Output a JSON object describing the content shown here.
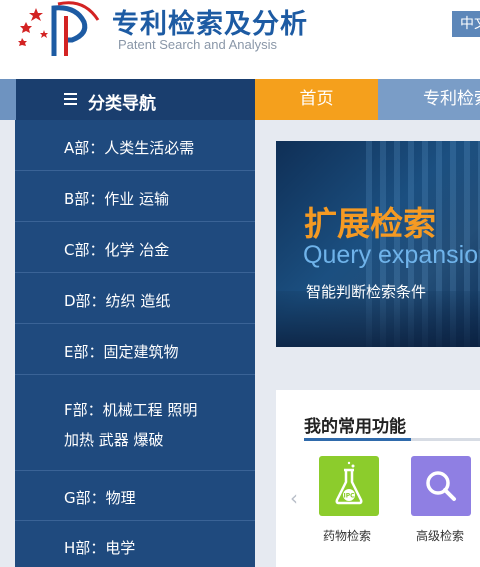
{
  "header": {
    "title": "专利检索及分析",
    "subtitle": "Patent Search and Analysis",
    "lang": "中文"
  },
  "nav": {
    "category_title": "分类导航",
    "home": "首页",
    "search": "专利检索"
  },
  "sidebar": {
    "items": [
      {
        "label": "A部：人类生活必需"
      },
      {
        "label": "B部：作业  运输"
      },
      {
        "label": "C部：化学  冶金"
      },
      {
        "label": "D部：纺织  造纸"
      },
      {
        "label": "E部：固定建筑物"
      },
      {
        "label": "F部：机械工程  照明  加热  武器  爆破"
      },
      {
        "label": "G部：物理"
      },
      {
        "label": "H部：电学"
      }
    ]
  },
  "banner": {
    "title": "扩展检索",
    "subtitle": "Query expansion",
    "desc": "智能判断检索条件"
  },
  "functions": {
    "title": "我的常用功能",
    "items": [
      {
        "label": "药物检索",
        "icon": "flask-ipc-icon",
        "color": "#8ccc2c"
      },
      {
        "label": "高级检索",
        "icon": "search-icon",
        "color": "#8f7fe3"
      }
    ]
  },
  "colors": {
    "brand": "#1d5ba3",
    "nav": "#7a9dc7",
    "sidebar": "#1f4a7e",
    "accent": "#f5a01c"
  }
}
